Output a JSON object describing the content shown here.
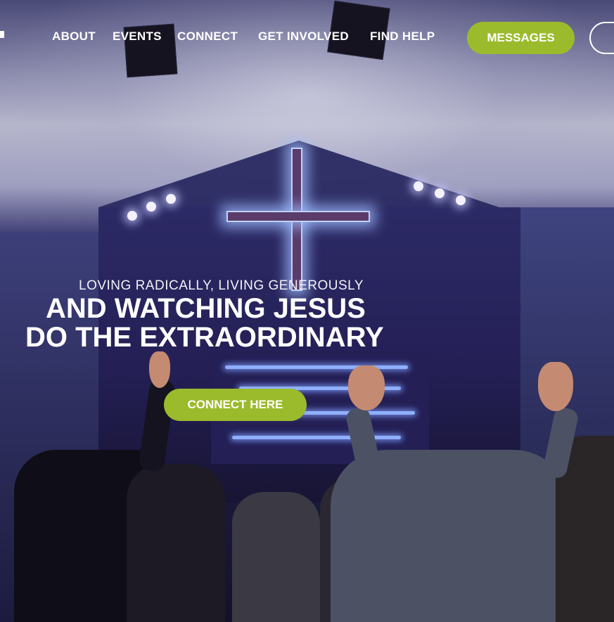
{
  "nav": {
    "items": [
      {
        "label": "ABOUT"
      },
      {
        "label": "EVENTS"
      },
      {
        "label": "CONNECT"
      },
      {
        "label": "GET INVOLVED"
      },
      {
        "label": "FIND HELP"
      }
    ],
    "cta": "MESSAGES"
  },
  "hero": {
    "subtitle": "LOVING RADICALLY, LIVING GENEROUSLY",
    "headline_line1": "AND WATCHING JESUS",
    "headline_line2": "DO THE EXTRAORDINARY",
    "cta": "CONNECT HERE"
  },
  "colors": {
    "accent": "#9bbb2c",
    "text": "#ffffff"
  }
}
